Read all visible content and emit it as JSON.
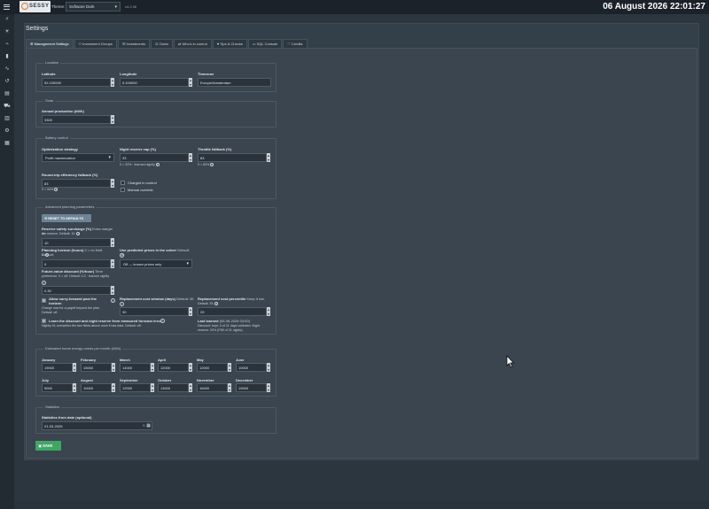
{
  "topbar": {
    "logo_text": "SESSY",
    "theme_label": "Theme:",
    "theme_value": "Software Dark",
    "version": "v4.0.96",
    "datetime": "06 August 2026 22:01:27"
  },
  "sidebar": {
    "icons": [
      "lightning-icon",
      "sun-icon",
      "plug-icon",
      "battery-icon",
      "chart-line-icon",
      "history-icon",
      "table-icon",
      "car-icon",
      "bar-chart-icon",
      "gear-icon",
      "document-icon"
    ]
  },
  "page": {
    "title": "Settings"
  },
  "tabs": [
    {
      "label": "Management Settings",
      "icon": "gear-icon",
      "active": true
    },
    {
      "label": "Investment Groups",
      "icon": "group-icon",
      "active": false
    },
    {
      "label": "Investments",
      "icon": "list-icon",
      "active": false
    },
    {
      "label": "Taxes",
      "icon": "tax-icon",
      "active": false
    },
    {
      "label": "Who's in control",
      "icon": "control-icon",
      "active": false
    },
    {
      "label": "Tips & Checks",
      "icon": "tips-icon",
      "active": false
    },
    {
      "label": "SQL Console",
      "icon": "console-icon",
      "active": false
    },
    {
      "label": "Credits",
      "icon": "heart-icon",
      "active": false
    }
  ],
  "location": {
    "legend": "Location",
    "latitude_label": "Latitude",
    "latitude_value": "52.100000",
    "longitude_label": "Longitude",
    "longitude_value": "5.100000",
    "timezone_label": "Timezone",
    "timezone_value": "Europe/Amsterdam"
  },
  "solar": {
    "legend": "Solar",
    "annual_label": "Annual production (kWh)",
    "annual_value": "3300"
  },
  "battery": {
    "legend": "Battery control",
    "strategy_label": "Optimization strategy",
    "strategy_value": "Profit maximization",
    "night_label": "Night reserve cap (%)",
    "night_value": "33",
    "night_help": "0 = 33% · learned nightly",
    "throttle_label": "Throttle fallback (%)",
    "throttle_value": "83",
    "throttle_help": "0 = 83%",
    "roundtrip_label": "Round-trip efficiency fallback (%)",
    "roundtrip_value": "83",
    "roundtrip_help": "0 = 94%",
    "charged_label": "Charged in control",
    "manual_label": "Manual override"
  },
  "advanced": {
    "legend": "Advanced planning parameters",
    "reset_label": "RESET TO DEFAULTS",
    "surcharge_label": "Reserve safety surcharge (%)",
    "surcharge_help_inline": "Extra margin on",
    "surcharge_help": "the reserve. Default: 10.",
    "surcharge_value": "10",
    "horizon_label": "Planning horizon (hours)",
    "horizon_help_inline": "0 = no limit. Default:",
    "horizon_help": "0.",
    "horizon_value": "0",
    "predicted_label": "Use predicted prices in the solver",
    "predicted_help_inline": "Default: Off.",
    "predicted_value": "Off — known prices only",
    "future_label": "Future-value discount (%/hour)",
    "future_help_inline": "Time",
    "future_help1": "preference. 0 = off. Default: 0.3 · learned nightly.",
    "future_value": "0.30",
    "carry_label": "Allow carry-forward past the horizon",
    "carry_help1": "Charge now for a payoff beyond the plan.",
    "carry_help2": "Default: off.",
    "window_label": "Replacement cost window (days)",
    "window_help_inline": "Default: 30.",
    "window_value": "30",
    "percentile_label": "Replacement cost percentile",
    "percentile_help_inline": "Keep it low.",
    "percentile_help": "Default: 25.",
    "percentile_value": "25",
    "learn_label": "Learn the discount and night reserve from measured forecast error",
    "learn_help": "Nightly fit; overwrites the two fields above once it has data. Default: off.",
    "last_learned_label": "Last learned",
    "last_learned_date": "(06-08-2026 03:00)",
    "last_learned_help1": "Discount: kept, 0 of 21 days collected. Night",
    "last_learned_help2": "reserve: 33% (P80 of 21 nights)."
  },
  "energy": {
    "legend": "Estimated home energy needs per month (kWh)",
    "months": [
      {
        "label": "January",
        "value": "19000"
      },
      {
        "label": "February",
        "value": "15000"
      },
      {
        "label": "March",
        "value": "14000"
      },
      {
        "label": "April",
        "value": "12000"
      },
      {
        "label": "May",
        "value": "12000"
      },
      {
        "label": "June",
        "value": "10000"
      },
      {
        "label": "July",
        "value": "9000"
      },
      {
        "label": "August",
        "value": "10000"
      },
      {
        "label": "September",
        "value": "12000"
      },
      {
        "label": "October",
        "value": "13000"
      },
      {
        "label": "November",
        "value": "16000"
      },
      {
        "label": "December",
        "value": "19000"
      }
    ]
  },
  "statistics": {
    "legend": "Statistics",
    "from_label": "Statistics from date (optional)",
    "from_value": "01-03-2026"
  },
  "actions": {
    "save_label": "SAVE"
  }
}
